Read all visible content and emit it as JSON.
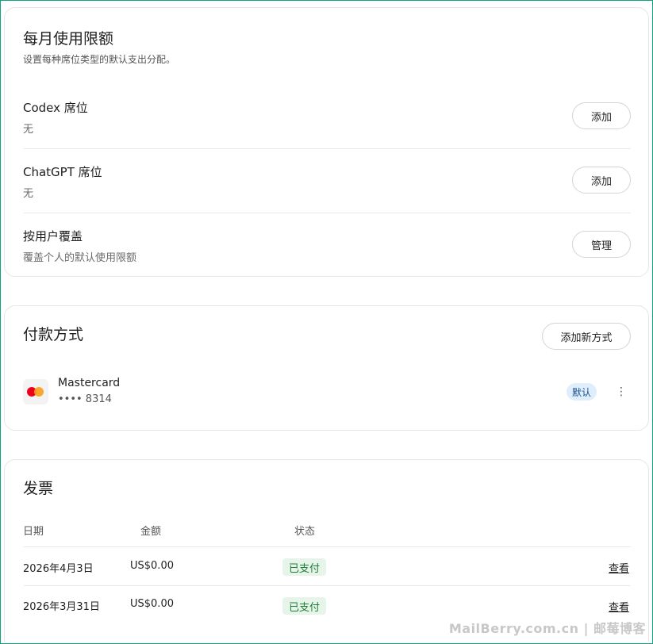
{
  "usage_limits": {
    "title": "每月使用限额",
    "subtitle": "设置每种席位类型的默认支出分配。",
    "rows": [
      {
        "title": "Codex 席位",
        "value": "无",
        "button": "添加"
      },
      {
        "title": "ChatGPT 席位",
        "value": "无",
        "button": "添加"
      },
      {
        "title": "按用户覆盖",
        "value": "覆盖个人的默认使用限额",
        "button": "管理"
      }
    ]
  },
  "payment": {
    "title": "付款方式",
    "add_button": "添加新方式",
    "method": {
      "brand": "Mastercard",
      "number": "•••• 8314",
      "badge": "默认",
      "more_icon": "⋮"
    }
  },
  "invoices": {
    "title": "发票",
    "columns": [
      "日期",
      "金额",
      "状态"
    ],
    "rows": [
      {
        "date": "2026年4月3日",
        "amount": "US$0.00",
        "status": "已支付",
        "action": "查看"
      },
      {
        "date": "2026年3月31日",
        "amount": "US$0.00",
        "status": "已支付",
        "action": "查看"
      }
    ]
  },
  "watermark": "MailBerry.com.cn | 邮莓博客",
  "colors": {
    "accent_border": "#10a37f",
    "badge_bg": "#dfeefd",
    "paid_bg": "#e6f4ea",
    "paid_text": "#1e7e34"
  }
}
